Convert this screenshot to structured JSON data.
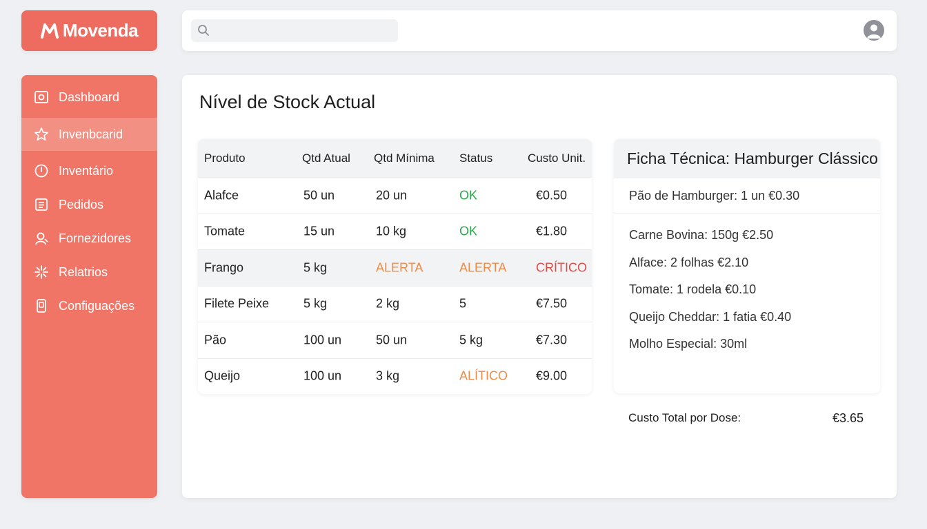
{
  "brand": {
    "name": "Movenda",
    "mark": "M",
    "color": "#ee6b5f"
  },
  "search": {
    "value": "",
    "placeholder": ""
  },
  "sidebar": {
    "color": "#f07566",
    "items": [
      {
        "label": "Dashboard",
        "icon": "dashboard-icon",
        "active": false
      },
      {
        "label": "Invenbcarid",
        "icon": "star-icon",
        "active": true
      },
      {
        "label": "Inventário",
        "icon": "clock-icon",
        "active": false
      },
      {
        "label": "Pedidos",
        "icon": "clipboard-icon",
        "active": false
      },
      {
        "label": "Fornezidores",
        "icon": "user-icon",
        "active": false
      },
      {
        "label": "Relatrios",
        "icon": "sparkle-icon",
        "active": false
      },
      {
        "label": "Configuações",
        "icon": "device-icon",
        "active": false
      }
    ]
  },
  "page": {
    "title": "Nível de Stock Actual"
  },
  "stock_table": {
    "headers": [
      "Produto",
      "Qtd Atual",
      "Qtd Mínima",
      "Status",
      "Custo Unit."
    ],
    "rows": [
      [
        "Alafce",
        "50 un",
        "20 un",
        "OK",
        "€0.50"
      ],
      [
        "Tomate",
        "15 un",
        "10 kg",
        "OK",
        "€1.80"
      ],
      [
        "Frango",
        "5 kg",
        "ALERTA",
        "ALERTA",
        "CRÍTICO"
      ],
      [
        "Filete Peixe",
        "5 kg",
        "2 kg",
        "5",
        "€7.50"
      ],
      [
        "Pão",
        "100 un",
        "50 un",
        "5 kg",
        "€7.30"
      ],
      [
        "Queijo",
        "100 un",
        "3 kg",
        "ALÍTICO",
        "€9.00"
      ]
    ],
    "status_colors": {
      "ok": "#2aa84a",
      "alert": "#ef8b45",
      "critical": "#e04a45"
    }
  },
  "recipe": {
    "title": "Ficha Técnica: Hamburger Clássico",
    "first_item": "Pão de Hamburger: 1 un €0.30",
    "items": [
      "Carne Bovina: 150g €2.50",
      "Alface: 2 folhas €2.10",
      "Tomate: 1 rodela €0.10",
      "Queijo Cheddar: 1 fatia €0.40",
      "Molho Especial: 30ml"
    ],
    "total_label": "Custo Total por Dose:",
    "total_value": "€3.65"
  }
}
